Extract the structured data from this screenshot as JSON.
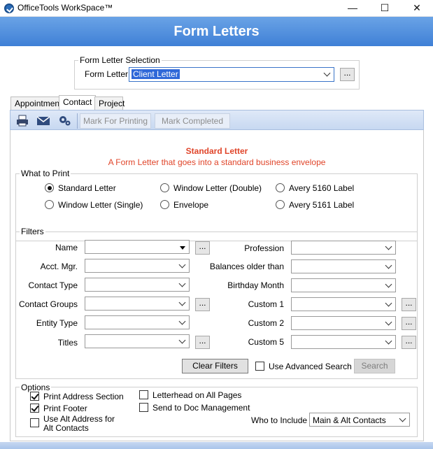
{
  "window": {
    "title": "OfficeTools WorkSpace™",
    "minimize": "—",
    "maximize": "☐",
    "close": "✕"
  },
  "header": {
    "title": "Form Letters"
  },
  "selection": {
    "legend": "Form Letter Selection",
    "label": "Form Letter",
    "value": "Client Letter",
    "ellipsis": "..."
  },
  "tabs": [
    {
      "label": "Appointment"
    },
    {
      "label": "Contact"
    },
    {
      "label": "Project"
    }
  ],
  "toolbar": {
    "icons": [
      "printer-icon",
      "envelope-icon",
      "gears-icon"
    ],
    "mark_printing": "Mark For Printing",
    "mark_completed": "Mark Completed"
  },
  "letter": {
    "title": "Standard Letter",
    "description": "A Form Letter that goes into a standard business envelope",
    "color": "#e0452a"
  },
  "what_to_print": {
    "legend": "What to Print",
    "options": [
      {
        "label": "Standard Letter",
        "selected": true
      },
      {
        "label": "Window Letter (Double)",
        "selected": false
      },
      {
        "label": "Avery 5160 Label",
        "selected": false
      },
      {
        "label": "Window Letter (Single)",
        "selected": false
      },
      {
        "label": "Envelope",
        "selected": false
      },
      {
        "label": "Avery 5161 Label",
        "selected": false
      }
    ]
  },
  "filters": {
    "legend": "Filters",
    "left": [
      {
        "label": "Name",
        "value": ""
      },
      {
        "label": "Acct. Mgr.",
        "value": ""
      },
      {
        "label": "Contact Type",
        "value": ""
      },
      {
        "label": "Contact Groups",
        "value": ""
      },
      {
        "label": "Entity Type",
        "value": ""
      },
      {
        "label": "Titles",
        "value": ""
      }
    ],
    "right": [
      {
        "label": "Profession",
        "value": ""
      },
      {
        "label": "Balances older than",
        "value": ""
      },
      {
        "label": "Birthday Month",
        "value": ""
      },
      {
        "label": "Custom 1",
        "value": ""
      },
      {
        "label": "Custom 2",
        "value": ""
      },
      {
        "label": "Custom 5",
        "value": ""
      }
    ],
    "ellipsis": "...",
    "clear_filters": "Clear Filters",
    "advanced_search": "Use Advanced Search",
    "search": "Search"
  },
  "options": {
    "legend": "Options",
    "print_address": "Print Address Section",
    "print_footer": "Print Footer",
    "alt_address_1": "Use Alt Address for",
    "alt_address_2": "Alt Contacts",
    "letterhead": "Letterhead on All Pages",
    "send_doc": "Send to Doc Management",
    "who_label": "Who to Include",
    "who_value": "Main & Alt Contacts"
  }
}
